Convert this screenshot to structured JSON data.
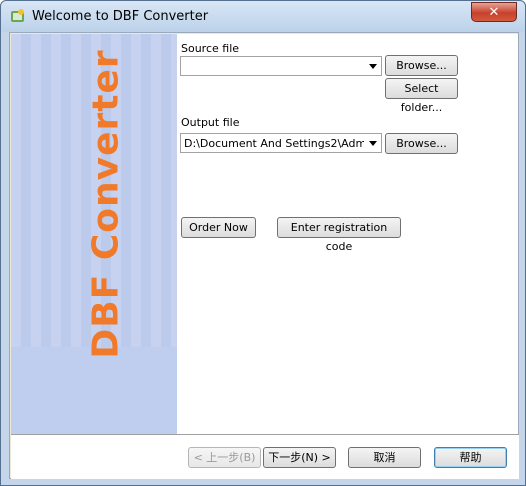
{
  "window": {
    "title": "Welcome to DBF Converter",
    "close_label": "✕"
  },
  "brand": {
    "text": "DBF Converter",
    "color": "#f07a2a"
  },
  "source": {
    "label": "Source file",
    "value": "",
    "browse_label": "Browse...",
    "select_folder_label": "Select folder..."
  },
  "output": {
    "label": "Output file",
    "value": "D:\\Document And Settings2\\Administr",
    "browse_label": "Browse..."
  },
  "actions": {
    "order_label": "Order Now",
    "register_label": "Enter registration code"
  },
  "footer": {
    "back_label": "< 上一步(B)",
    "next_label": "下一步(N) >",
    "cancel_label": "取消",
    "help_label": "帮助"
  },
  "icons": {
    "app": "app-icon",
    "dropdown": "chevron-down-icon"
  }
}
